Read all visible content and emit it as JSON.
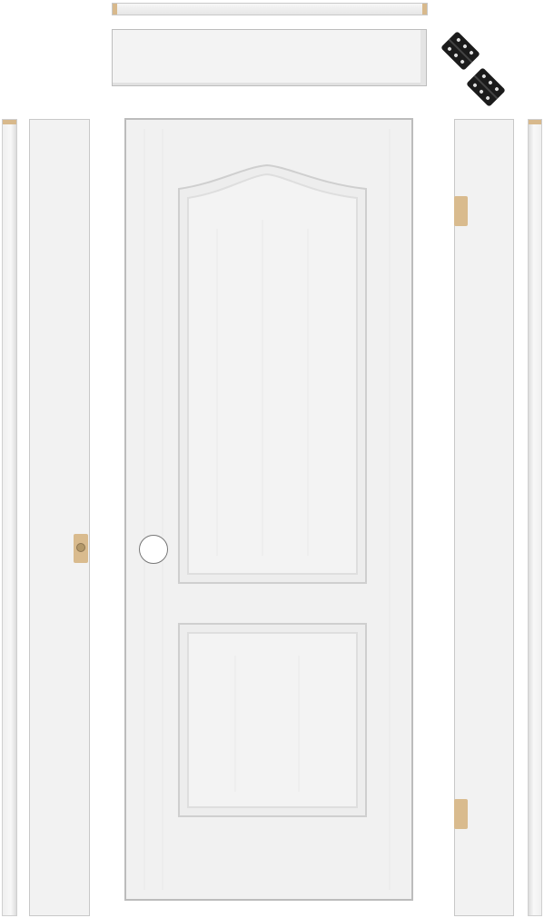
{
  "scene": "prehung-door-kit",
  "parts": {
    "door": {
      "style": "two-panel-arch-top",
      "color": "#f1f1f1"
    },
    "head_casing": {
      "color": "#f3f3f3"
    },
    "head_jamb": {
      "color": "#f3f3f3"
    },
    "side_jambs": {
      "color": "#f2f2f2"
    },
    "side_casings": {
      "color": "#f5f5f5"
    },
    "hardware": {
      "hinge_count": 2,
      "hinge_color": "#1b1b1b",
      "mortise_color": "#d9bb8e"
    }
  }
}
